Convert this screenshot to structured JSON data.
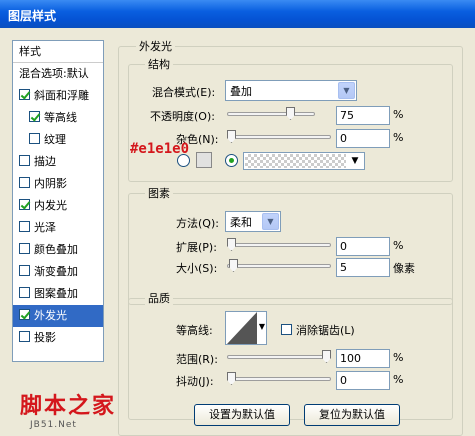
{
  "window": {
    "title": "图层样式"
  },
  "sidebar": {
    "header": "样式",
    "items": [
      {
        "label": "混合选项:默认",
        "checkbox": false,
        "checked": false
      },
      {
        "label": "斜面和浮雕",
        "checkbox": true,
        "checked": true
      },
      {
        "label": "等高线",
        "checkbox": true,
        "checked": true,
        "sub": true
      },
      {
        "label": "纹理",
        "checkbox": true,
        "checked": false,
        "sub": true
      },
      {
        "label": "描边",
        "checkbox": true,
        "checked": false
      },
      {
        "label": "内阴影",
        "checkbox": true,
        "checked": false
      },
      {
        "label": "内发光",
        "checkbox": true,
        "checked": true
      },
      {
        "label": "光泽",
        "checkbox": true,
        "checked": false
      },
      {
        "label": "颜色叠加",
        "checkbox": true,
        "checked": false
      },
      {
        "label": "渐变叠加",
        "checkbox": true,
        "checked": false
      },
      {
        "label": "图案叠加",
        "checkbox": true,
        "checked": false
      },
      {
        "label": "外发光",
        "checkbox": true,
        "checked": true,
        "selected": true
      },
      {
        "label": "投影",
        "checkbox": true,
        "checked": false
      }
    ]
  },
  "outer_glow": {
    "title": "外发光",
    "structure": {
      "title": "结构",
      "blend_mode_label": "混合模式(E):",
      "blend_mode_value": "叠加",
      "opacity_label": "不透明度(O):",
      "opacity_value": "75",
      "opacity_fraction": 0.75,
      "noise_label": "杂色(N):",
      "noise_value": "0",
      "noise_fraction": 0.0,
      "unit_percent": "%",
      "color_annotation": "#e1e1e0",
      "color_swatch": "#e1e1e0"
    },
    "elements": {
      "title": "图素",
      "method_label": "方法(Q):",
      "method_value": "柔和",
      "spread_label": "扩展(P):",
      "spread_value": "0",
      "spread_fraction": 0.0,
      "size_label": "大小(S):",
      "size_value": "5",
      "size_unit": "像素",
      "size_fraction": 0.02,
      "unit_percent": "%"
    },
    "quality": {
      "title": "品质",
      "contour_label": "等高线:",
      "antialias_label": "消除锯齿(L)",
      "antialias_checked": false,
      "range_label": "范围(R):",
      "range_value": "100",
      "range_fraction": 1.0,
      "jitter_label": "抖动(J):",
      "jitter_value": "0",
      "jitter_fraction": 0.0,
      "unit_percent": "%"
    },
    "buttons": {
      "make_default": "设置为默认值",
      "reset_default": "复位为默认值"
    }
  },
  "watermark": {
    "text": "脚本之家",
    "url": "JB51.Net"
  },
  "colors": {
    "accent": "#316ac5",
    "annotation": "#d4171c"
  }
}
